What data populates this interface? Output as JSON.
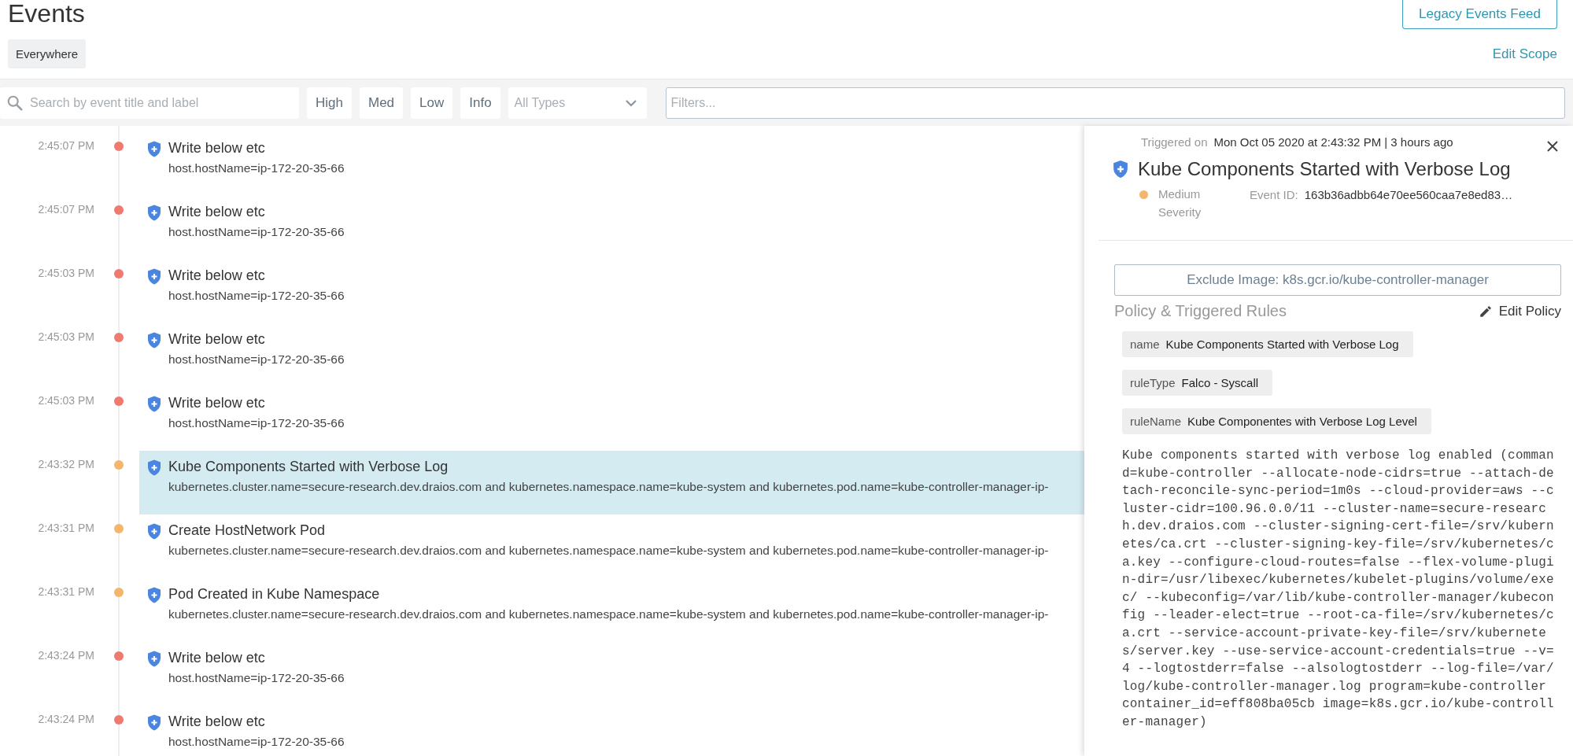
{
  "header": {
    "title": "Events",
    "legacy_button": "Legacy Events Feed",
    "scope_chip": "Everywhere",
    "edit_scope": "Edit Scope"
  },
  "toolbar": {
    "search": {
      "placeholder": "Search by event title and label"
    },
    "severity_buttons": [
      "High",
      "Med",
      "Low",
      "Info"
    ],
    "type_select": {
      "placeholder": "All Types"
    },
    "filters": {
      "placeholder": "Filters..."
    }
  },
  "events": [
    {
      "time": "2:45:07 PM",
      "title": "Write below etc",
      "detail": "host.hostName=ip-172-20-35-66",
      "color": "#ef7b70",
      "selected": false
    },
    {
      "time": "2:45:07 PM",
      "title": "Write below etc",
      "detail": "host.hostName=ip-172-20-35-66",
      "color": "#ef7b70",
      "selected": false
    },
    {
      "time": "2:45:03 PM",
      "title": "Write below etc",
      "detail": "host.hostName=ip-172-20-35-66",
      "color": "#ef7b70",
      "selected": false
    },
    {
      "time": "2:45:03 PM",
      "title": "Write below etc",
      "detail": "host.hostName=ip-172-20-35-66",
      "color": "#ef7b70",
      "selected": false
    },
    {
      "time": "2:45:03 PM",
      "title": "Write below etc",
      "detail": "host.hostName=ip-172-20-35-66",
      "color": "#ef7b70",
      "selected": false
    },
    {
      "time": "2:43:32 PM",
      "title": "Kube Components Started with Verbose Log",
      "detail": "kubernetes.cluster.name=secure-research.dev.draios.com and kubernetes.namespace.name=kube-system and kubernetes.pod.name=kube-controller-manager-ip-",
      "color": "#f5b56b",
      "selected": true
    },
    {
      "time": "2:43:31 PM",
      "title": "Create HostNetwork Pod",
      "detail": "kubernetes.cluster.name=secure-research.dev.draios.com and kubernetes.namespace.name=kube-system and kubernetes.pod.name=kube-controller-manager-ip-",
      "color": "#f5b56b",
      "selected": false
    },
    {
      "time": "2:43:31 PM",
      "title": "Pod Created in Kube Namespace",
      "detail": "kubernetes.cluster.name=secure-research.dev.draios.com and kubernetes.namespace.name=kube-system and kubernetes.pod.name=kube-controller-manager-ip-",
      "color": "#f5b56b",
      "selected": false
    },
    {
      "time": "2:43:24 PM",
      "title": "Write below etc",
      "detail": "host.hostName=ip-172-20-35-66",
      "color": "#ef7b70",
      "selected": false
    },
    {
      "time": "2:43:24 PM",
      "title": "Write below etc",
      "detail": "host.hostName=ip-172-20-35-66",
      "color": "#ef7b70",
      "selected": false
    }
  ],
  "detail_panel": {
    "triggered_label": "Triggered on",
    "triggered_value": "Mon Oct 05 2020 at 2:43:32 PM | 3 hours ago",
    "title": "Kube Components Started with Verbose Log",
    "severity": {
      "label": "Medium Severity",
      "color": "#f5b56b"
    },
    "event_id_label": "Event ID:",
    "event_id": "163b36adbb64e70ee560caa7e8ed83…",
    "exclude_button": "Exclude Image: k8s.gcr.io/kube-controller-manager",
    "section_title": "Policy & Triggered Rules",
    "edit_policy": "Edit Policy",
    "rules": [
      {
        "key": "name",
        "value": "Kube Components Started with Verbose Log"
      },
      {
        "key": "ruleType",
        "value": "Falco - Syscall"
      },
      {
        "key": "ruleName",
        "value": "Kube Componentes with Verbose Log Level"
      }
    ],
    "description": "Kube components started with verbose log enabled (command=kube-controller --allocate-node-cidrs=true --attach-detach-reconcile-sync-period=1m0s --cloud-provider=aws --cluster-cidr=100.96.0.0/11 --cluster-name=secure-research.dev.draios.com --cluster-signing-cert-file=/srv/kubernetes/ca.crt --cluster-signing-key-file=/srv/kubernetes/ca.key --configure-cloud-routes=false --flex-volume-plugin-dir=/usr/libexec/kubernetes/kubelet-plugins/volume/exec/ --kubeconfig=/var/lib/kube-controller-manager/kubeconfig --leader-elect=true --root-ca-file=/srv/kubernetes/ca.crt --service-account-private-key-file=/srv/kubernetes/server.key --use-service-account-credentials=true --v=4 --logtostderr=false --alsologtostderr --log-file=/var/log/kube-controller-manager.log program=kube-controller container_id=eff808ba05cb image=k8s.gcr.io/kube-controller-manager)"
  }
}
